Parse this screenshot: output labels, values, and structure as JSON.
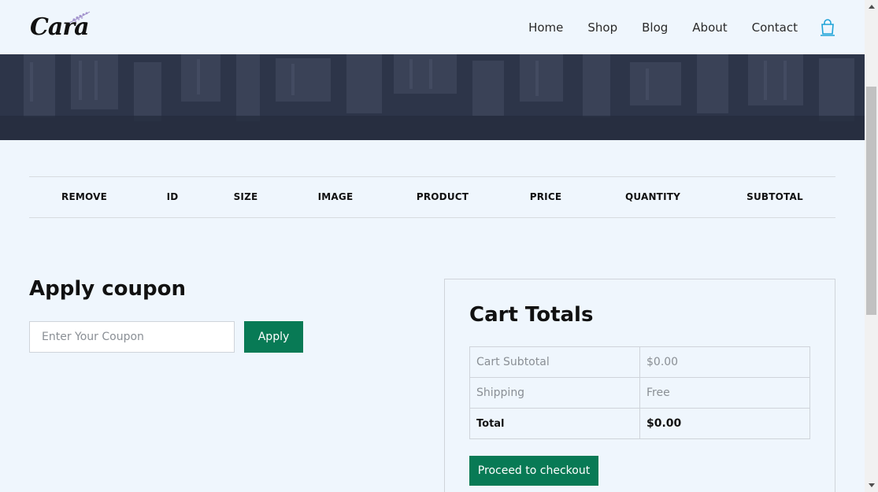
{
  "header": {
    "logo_text": "Cara",
    "nav": [
      {
        "label": "Home"
      },
      {
        "label": "Shop"
      },
      {
        "label": "Blog"
      },
      {
        "label": "About"
      },
      {
        "label": "Contact"
      }
    ],
    "cart_icon": "shopping-bag-icon"
  },
  "cart_table": {
    "columns": [
      "REMOVE",
      "ID",
      "SIZE",
      "IMAGE",
      "PRODUCT",
      "PRICE",
      "QUANTITY",
      "SUBTOTAL"
    ],
    "rows": []
  },
  "coupon": {
    "title": "Apply coupon",
    "placeholder": "Enter Your Coupon",
    "value": "",
    "apply_label": "Apply"
  },
  "totals": {
    "title": "Cart Totals",
    "rows": [
      {
        "label": "Cart Subtotal",
        "value": "$0.00"
      },
      {
        "label": "Shipping",
        "value": "Free"
      },
      {
        "label": "Total",
        "value": "$0.00"
      }
    ],
    "checkout_label": "Proceed to checkout"
  },
  "colors": {
    "background": "#eff6fd",
    "accent": "#087a55",
    "cart_icon": "#1fa3d8"
  }
}
